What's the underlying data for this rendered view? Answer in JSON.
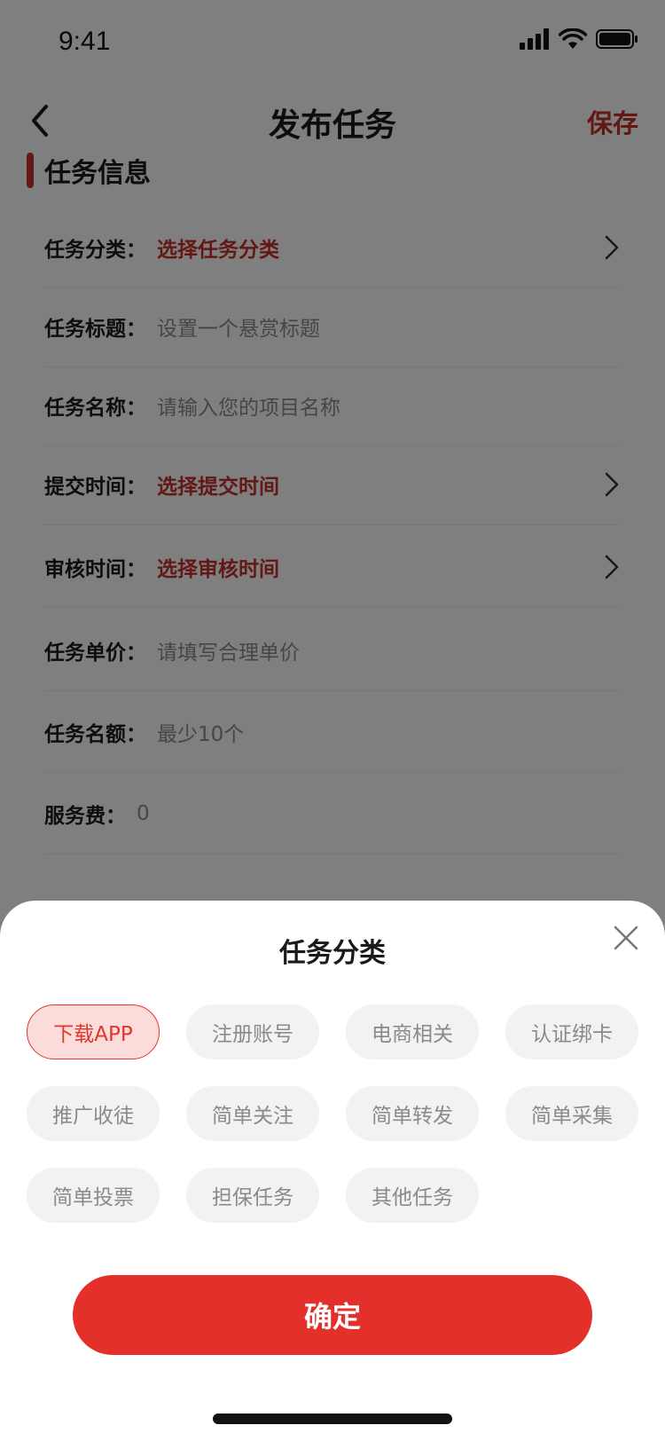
{
  "status_bar": {
    "time": "9:41",
    "icons": [
      "signal-icon",
      "wifi-icon",
      "battery-icon"
    ]
  },
  "nav": {
    "title": "发布任务",
    "save_label": "保存",
    "back_icon": "chevron-left-icon"
  },
  "section": {
    "title": "任务信息"
  },
  "form": {
    "rows": [
      {
        "label": "任务分类：",
        "value": "选择任务分类",
        "type": "picker"
      },
      {
        "label": "任务标题：",
        "value": "设置一个悬赏标题",
        "type": "input"
      },
      {
        "label": "任务名称：",
        "value": "请输入您的项目名称",
        "type": "input"
      },
      {
        "label": "提交时间：",
        "value": "选择提交时间",
        "type": "picker"
      },
      {
        "label": "审核时间：",
        "value": "选择审核时间",
        "type": "picker"
      },
      {
        "label": "任务单价：",
        "value": "请填写合理单价",
        "type": "input"
      },
      {
        "label": "任务名额：",
        "value": "最少10个",
        "type": "input"
      },
      {
        "label": "服务费：",
        "value": "0",
        "type": "readonly"
      }
    ]
  },
  "sheet": {
    "title": "任务分类",
    "selected": "下载APP",
    "options": [
      "下载APP",
      "注册账号",
      "电商相关",
      "认证绑卡",
      "推广收徒",
      "简单关注",
      "简单转发",
      "简单采集",
      "简单投票",
      "担保任务",
      "其他任务"
    ],
    "confirm_label": "确定"
  },
  "colors": {
    "accent": "#e3302b",
    "accent_text": "#c6312a",
    "chip_selected_bg": "#fbdcda",
    "chip_bg": "#f2f2f2"
  }
}
